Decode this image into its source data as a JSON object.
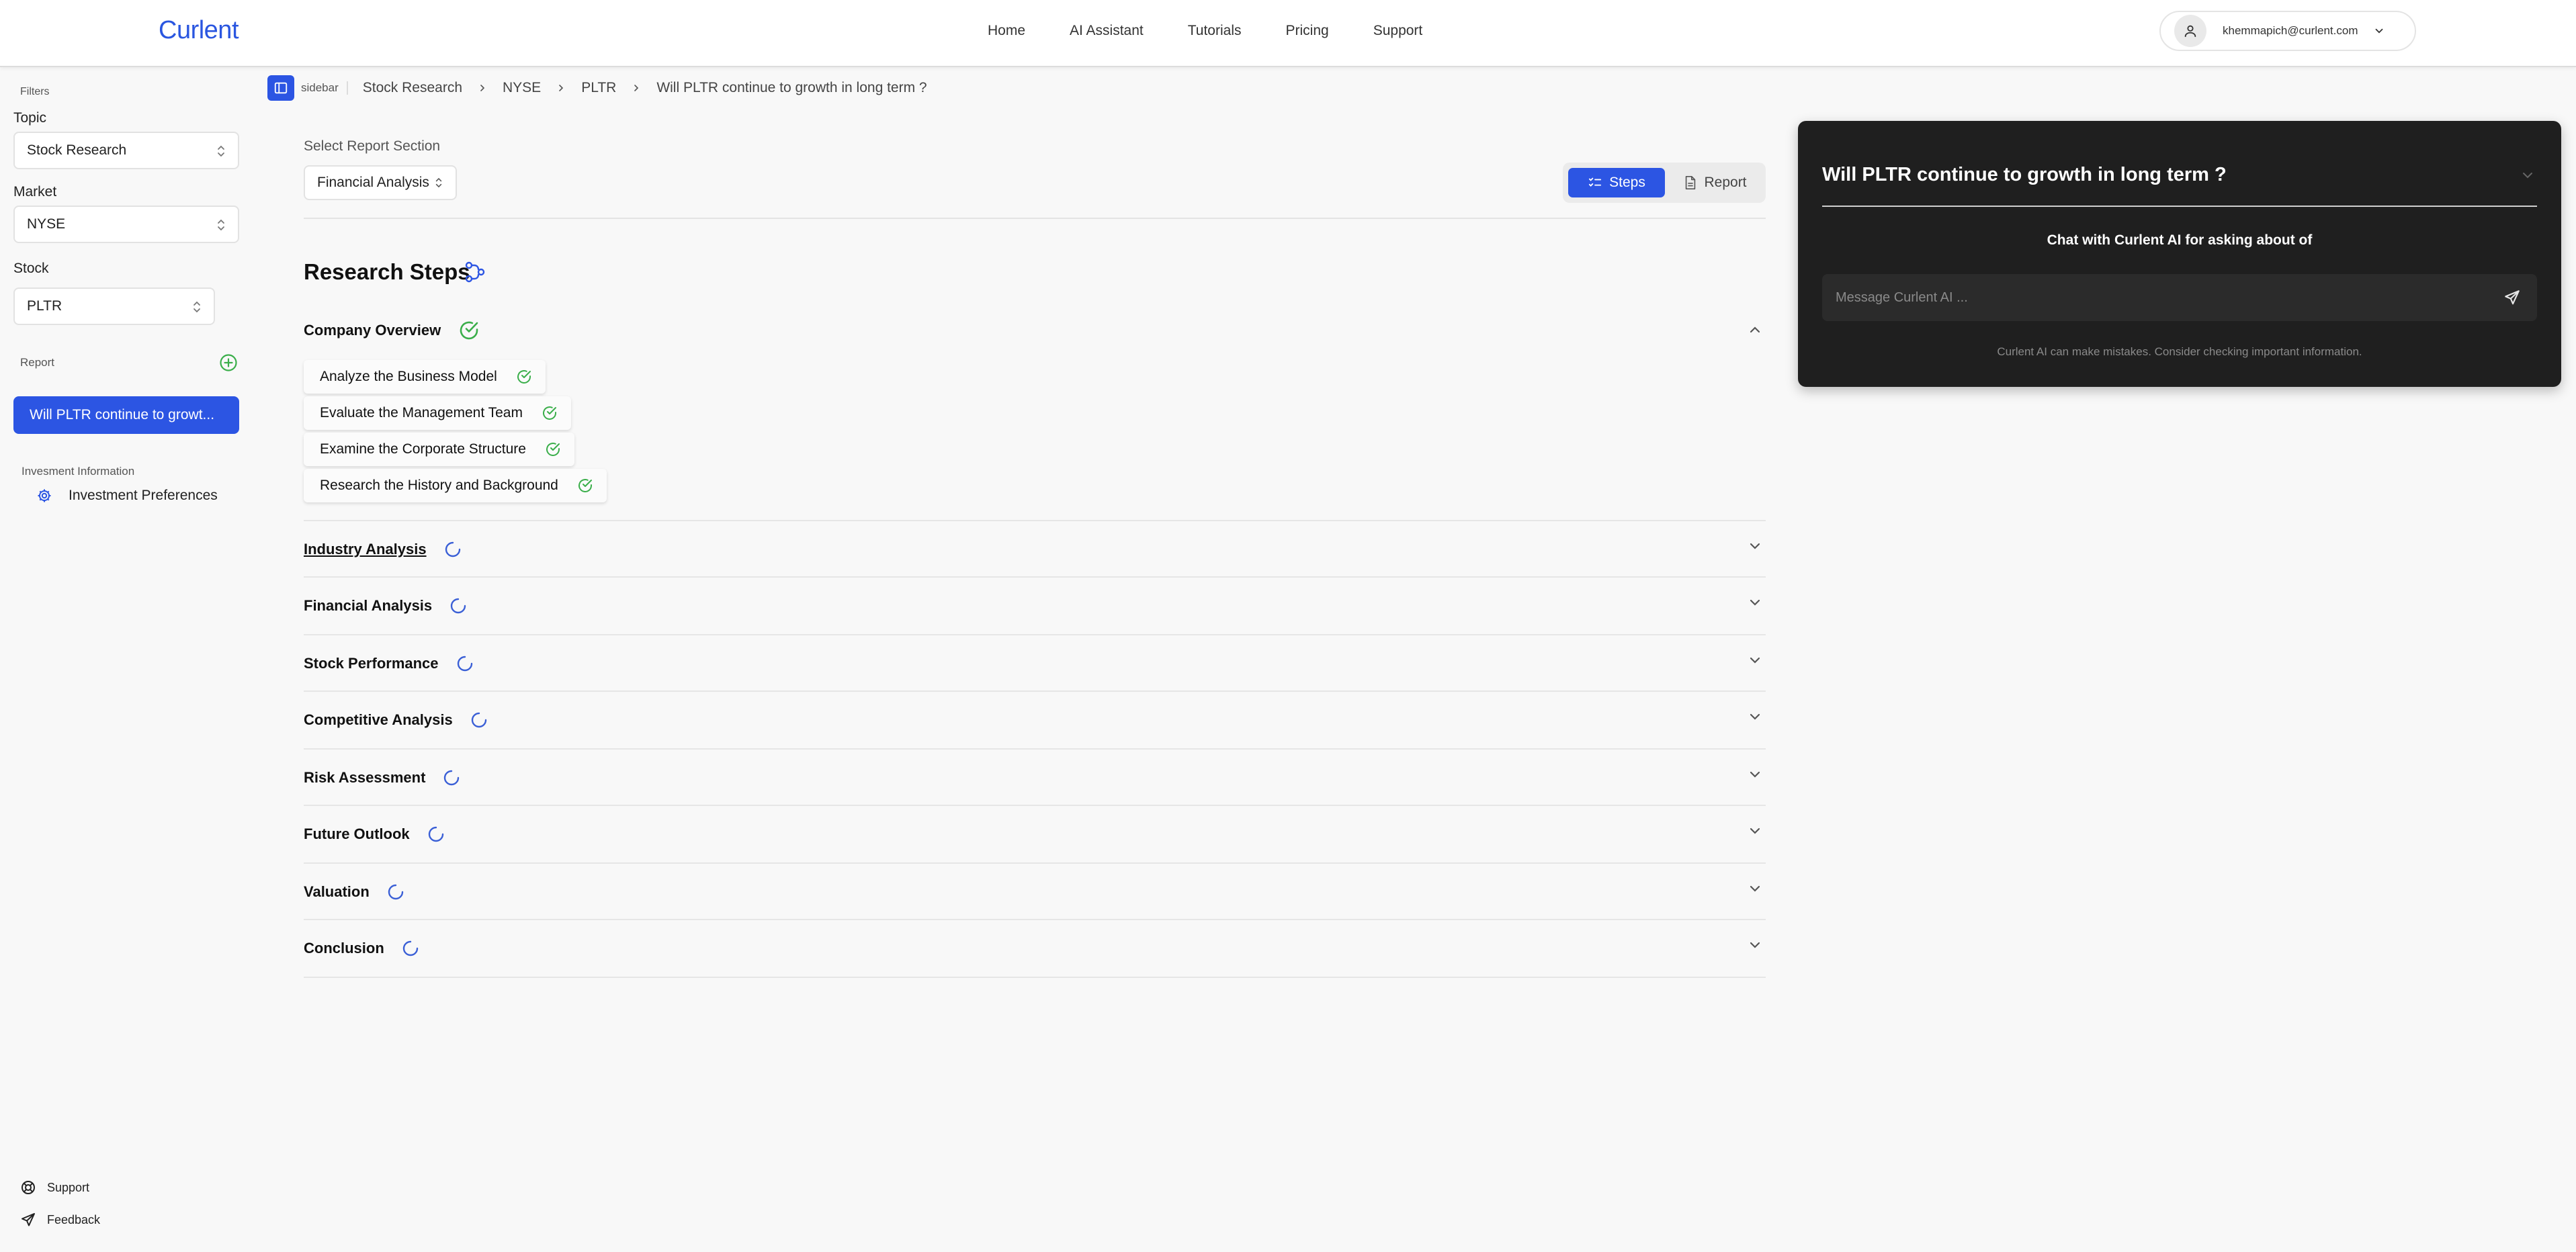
{
  "header": {
    "logo": "Curlent",
    "nav": [
      "Home",
      "AI Assistant",
      "Tutorials",
      "Pricing",
      "Support"
    ],
    "user_email": "khemmapich@curlent.com"
  },
  "sidebar": {
    "filters_label": "Filters",
    "topic_label": "Topic",
    "topic_value": "Stock Research",
    "market_label": "Market",
    "market_value": "NYSE",
    "stock_label": "Stock",
    "stock_value": "PLTR",
    "report_label": "Report",
    "report_item": "Will PLTR continue to growt...",
    "investment_info_label": "Invesment Information",
    "investment_preferences": "Investment Preferences",
    "support": "Support",
    "feedback": "Feedback"
  },
  "breadcrumb": {
    "sidebar_label": "sidebar",
    "items": [
      "Stock Research",
      "NYSE",
      "PLTR"
    ],
    "current": "Will PLTR continue to growth in long term ?"
  },
  "main": {
    "select_section_label": "Select Report Section",
    "section_value": "Financial Analysis",
    "toggle_steps": "Steps",
    "toggle_report": "Report",
    "research_steps_title": "Research Steps",
    "sections": [
      {
        "title": "Company Overview",
        "status": "complete",
        "expanded": true
      },
      {
        "title": "Industry Analysis",
        "status": "loading"
      },
      {
        "title": "Financial Analysis",
        "status": "loading"
      },
      {
        "title": "Stock Performance",
        "status": "loading"
      },
      {
        "title": "Competitive Analysis",
        "status": "loading"
      },
      {
        "title": "Risk Assessment",
        "status": "loading"
      },
      {
        "title": "Future Outlook",
        "status": "loading"
      },
      {
        "title": "Valuation",
        "status": "loading"
      },
      {
        "title": "Conclusion",
        "status": "loading"
      }
    ],
    "company_overview_steps": [
      "Analyze the Business Model",
      "Evaluate the Management Team",
      "Examine the Corporate Structure",
      "Research the History and Background"
    ]
  },
  "chat": {
    "title": "Will PLTR continue to growth in long term ?",
    "subtitle": "Chat with Curlent AI for asking about of",
    "placeholder": "Message Curlent AI ...",
    "disclaimer": "Curlent AI can make mistakes. Consider checking important information."
  },
  "colors": {
    "accent": "#2c55e3",
    "success": "#3aae4a",
    "chat_bg": "#1f1f1f"
  }
}
